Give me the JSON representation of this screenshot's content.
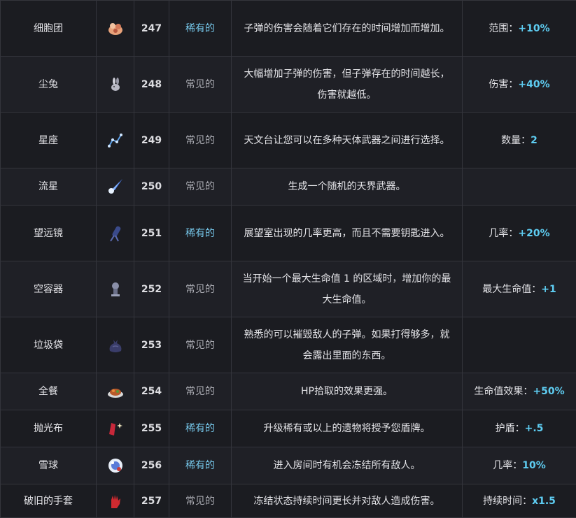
{
  "items": [
    {
      "name": "细胞团",
      "icon": "cell-cluster-icon",
      "id": "247",
      "rarity": "稀有的",
      "rare": true,
      "desc": "子弹的伤害会随着它们存在的时间增加而增加。",
      "stat_label": "范围：",
      "stat_value": "+10%"
    },
    {
      "name": "尘兔",
      "icon": "dust-bunny-icon",
      "id": "248",
      "rarity": "常见的",
      "rare": false,
      "desc": "大幅增加子弹的伤害，但子弹存在的时间越长，伤害就越低。",
      "stat_label": "伤害：",
      "stat_value": "+40%"
    },
    {
      "name": "星座",
      "icon": "constellation-icon",
      "id": "249",
      "rarity": "常见的",
      "rare": false,
      "desc": "天文台让您可以在多种天体武器之间进行选择。",
      "stat_label": "数量：",
      "stat_value": "2"
    },
    {
      "name": "流星",
      "icon": "meteor-icon",
      "id": "250",
      "rarity": "常见的",
      "rare": false,
      "desc": "生成一个随机的天界武器。",
      "stat_label": "",
      "stat_value": ""
    },
    {
      "name": "望远镜",
      "icon": "telescope-icon",
      "id": "251",
      "rarity": "稀有的",
      "rare": true,
      "desc": "展望室出现的几率更高，而且不需要钥匙进入。",
      "stat_label": "几率：",
      "stat_value": "+20%"
    },
    {
      "name": "空容器",
      "icon": "empty-vessel-icon",
      "id": "252",
      "rarity": "常见的",
      "rare": false,
      "desc": "当开始一个最大生命值 1 的区域时，增加你的最大生命值。",
      "stat_label": "最大生命值：",
      "stat_value": "+1"
    },
    {
      "name": "垃圾袋",
      "icon": "garbage-bag-icon",
      "id": "253",
      "rarity": "常见的",
      "rare": false,
      "desc": "熟悉的可以摧毁敌人的子弹。如果打得够多，就会露出里面的东西。",
      "stat_label": "",
      "stat_value": ""
    },
    {
      "name": "全餐",
      "icon": "full-meal-icon",
      "id": "254",
      "rarity": "常见的",
      "rare": false,
      "desc": "HP拾取的效果更强。",
      "stat_label": "生命值效果：",
      "stat_value": "+50%"
    },
    {
      "name": "抛光布",
      "icon": "polishing-cloth-icon",
      "id": "255",
      "rarity": "稀有的",
      "rare": true,
      "desc": "升级稀有或以上的遗物将授予您盾牌。",
      "stat_label": "护盾：",
      "stat_value": "+.5"
    },
    {
      "name": "雪球",
      "icon": "snowball-icon",
      "id": "256",
      "rarity": "稀有的",
      "rare": true,
      "desc": "进入房间时有机会冻结所有敌人。",
      "stat_label": "几率：",
      "stat_value": "10%"
    },
    {
      "name": "破旧的手套",
      "icon": "worn-glove-icon",
      "id": "257",
      "rarity": "常见的",
      "rare": false,
      "desc": "冻结状态持续时间更长并对敌人造成伤害。",
      "stat_label": "持续时间：",
      "stat_value": "x1.5"
    }
  ],
  "colors": {
    "rare": "#76c7ea",
    "common": "#a8a9b0",
    "stat": "#5ecdf2",
    "background": "#1b1c21",
    "border": "#34353c"
  }
}
